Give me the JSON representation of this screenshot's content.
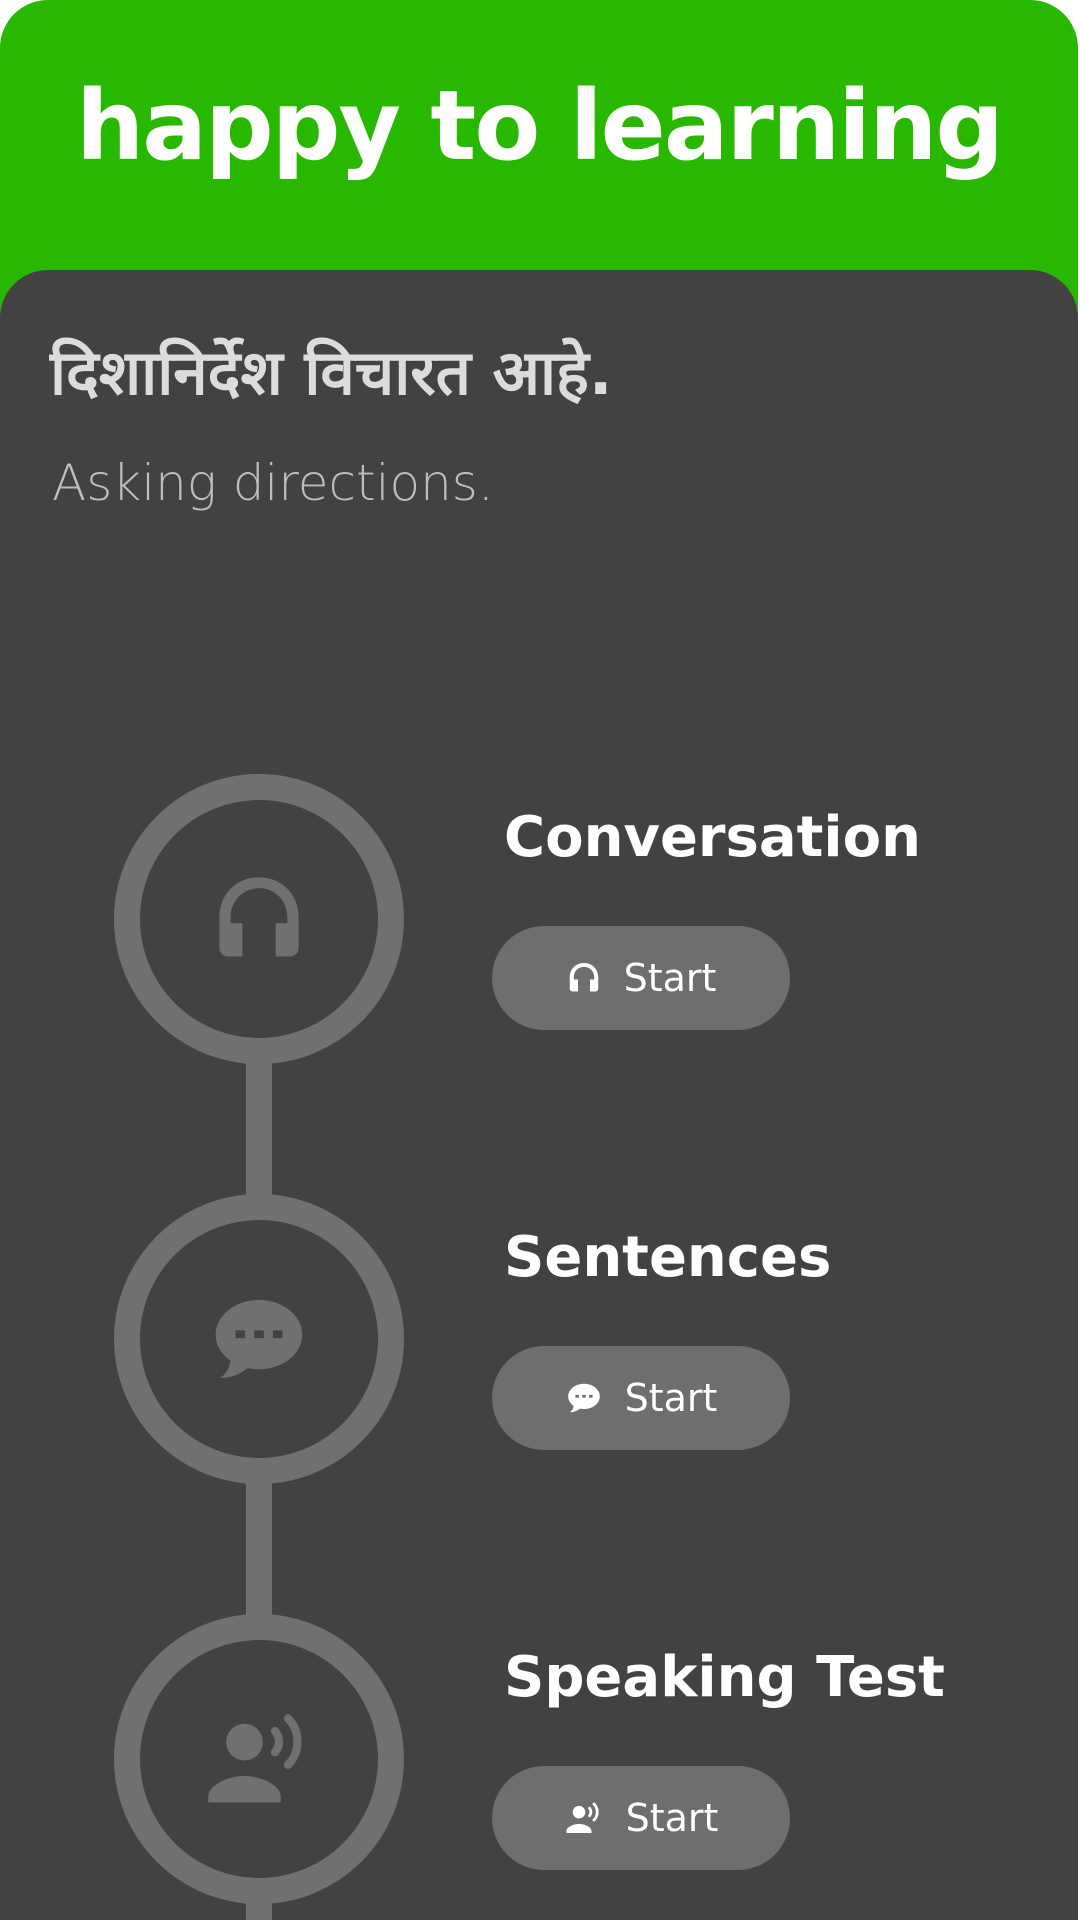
{
  "header": {
    "title": "happy to learning"
  },
  "lesson": {
    "title": "दिशानिर्देश विचारत आहे.",
    "subtitle": "Asking directions."
  },
  "colors": {
    "accent": "#29b800",
    "panel": "#424242",
    "step_ring": "#707070",
    "button": "#6e6e6e",
    "text": "#ffffff"
  },
  "steps": [
    {
      "label": "Conversation",
      "icon": "headphones-icon",
      "button_label": "Start"
    },
    {
      "label": "Sentences",
      "icon": "chat-bubble-icon",
      "button_label": "Start"
    },
    {
      "label": "Speaking Test",
      "icon": "speaking-person-icon",
      "button_label": "Start"
    }
  ]
}
